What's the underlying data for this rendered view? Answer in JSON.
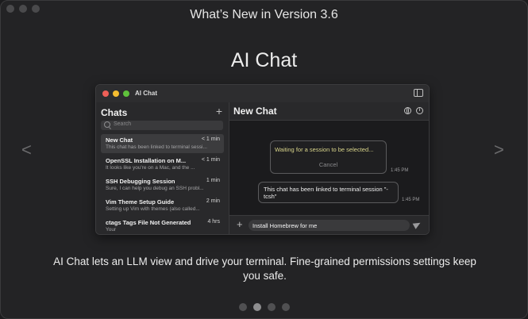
{
  "window": {
    "title": "What’s New in Version 3.6"
  },
  "hero": {
    "title": "AI Chat"
  },
  "nav": {
    "prev": "<",
    "next": ">"
  },
  "app": {
    "title": "AI Chat",
    "sidebar": {
      "heading": "Chats",
      "new_button": "+",
      "search_placeholder": "Search",
      "items": [
        {
          "title": "New Chat",
          "time": "< 1 min",
          "subtitle": "This chat has been linked to terminal sessi...",
          "active": true
        },
        {
          "title": "OpenSSL Installation on M...",
          "time": "< 1 min",
          "subtitle": "It looks like you're on a Mac, and the ..."
        },
        {
          "title": "SSH Debugging Session",
          "time": "1 min",
          "subtitle": "Sure, I can help you debug an SSH probl..."
        },
        {
          "title": "Vim Theme Setup Guide",
          "time": "2 min",
          "subtitle": "Setting up Vim with themes (also called..."
        },
        {
          "title": "ctags Tags File Not Generated",
          "time": "4 hrs",
          "subtitle": "Your"
        }
      ]
    },
    "main": {
      "title": "New Chat",
      "messages": [
        {
          "text": "Waiting for a session to be selected...",
          "action": "Cancel",
          "time": "1:45 PM"
        },
        {
          "text": "This chat has been linked to terminal session \"-tcsh\"",
          "time": "1:45 PM"
        }
      ],
      "attach_button": "+",
      "input_value": "Install Homebrew for me"
    }
  },
  "description": "AI Chat lets an LLM view and drive your terminal. Fine-grained permissions settings keep you safe.",
  "pager": {
    "count": 4,
    "active_index": 1
  }
}
